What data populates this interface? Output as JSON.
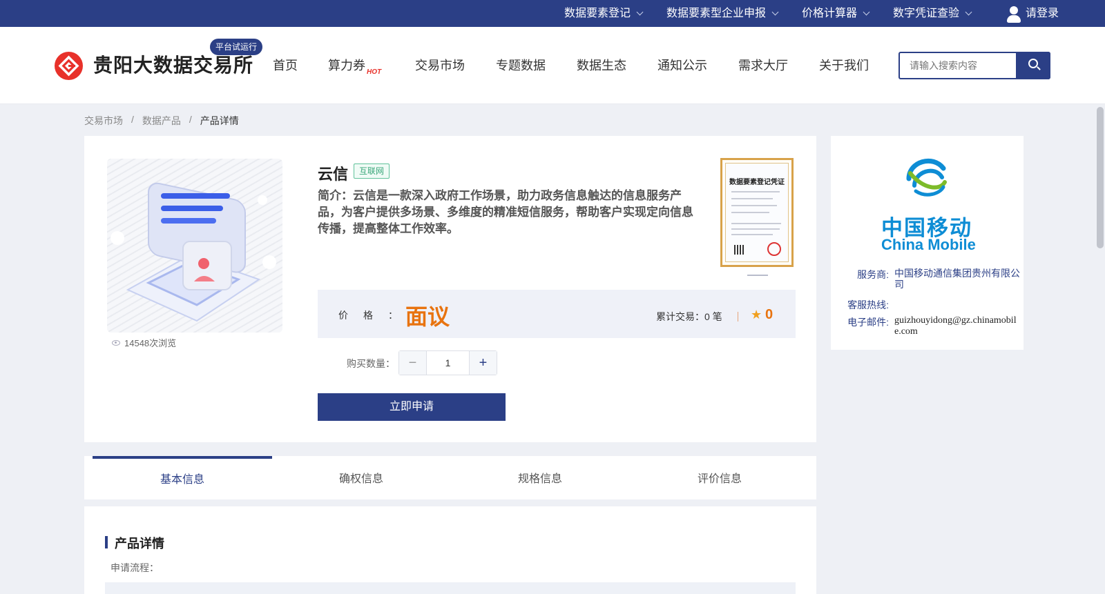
{
  "topbar": {
    "items": [
      "数据要素登记",
      "数据要素型企业申报",
      "价格计算器",
      "数字凭证查验"
    ],
    "login": "请登录"
  },
  "header": {
    "brand": "贵阳大数据交易所",
    "badge": "平台试运行",
    "nav": [
      "首页",
      "算力券",
      "交易市场",
      "专题数据",
      "数据生态",
      "通知公示",
      "需求大厅",
      "关于我们"
    ],
    "hot_tag": "HOT",
    "search_placeholder": "请输入搜索内容"
  },
  "breadcrumb": [
    "交易市场",
    "数据产品",
    "产品详情"
  ],
  "product": {
    "name": "云信",
    "category": "互联网",
    "intro": "简介：云信是一款深入政府工作场景，助力政务信息触达的信息服务产品，为客户提供多场景、多维度的精准短信服务，帮助客户实现定向信息传播，提高整体工作效率。",
    "views": "14548次浏览",
    "cert_title": "数据要素登记凭证",
    "price_label": "价格：",
    "price_value": "面议",
    "trades": "累计交易：0 笔",
    "rating": "0",
    "qty_label": "购买数量：",
    "qty_value": "1",
    "apply": "立即申请"
  },
  "provider": {
    "logo_cn": "中国移动",
    "logo_en": "China Mobile",
    "rows": [
      {
        "k": "服务商:",
        "v": "中国移动通信集团贵州有限公司"
      },
      {
        "k": "客服热线:",
        "v": ""
      },
      {
        "k": "电子邮件:",
        "v": "guizhouyidong@gz.chinamobile.com"
      }
    ]
  },
  "tabs": [
    "基本信息",
    "确权信息",
    "规格信息",
    "评价信息"
  ],
  "detail": {
    "title": "产品详情",
    "flow_label": "申请流程："
  },
  "colors": {
    "brand": "#2b3f86",
    "price": "#e8730f",
    "logo_red": "#e8312a",
    "mobile_blue": "#0e8dd5"
  }
}
